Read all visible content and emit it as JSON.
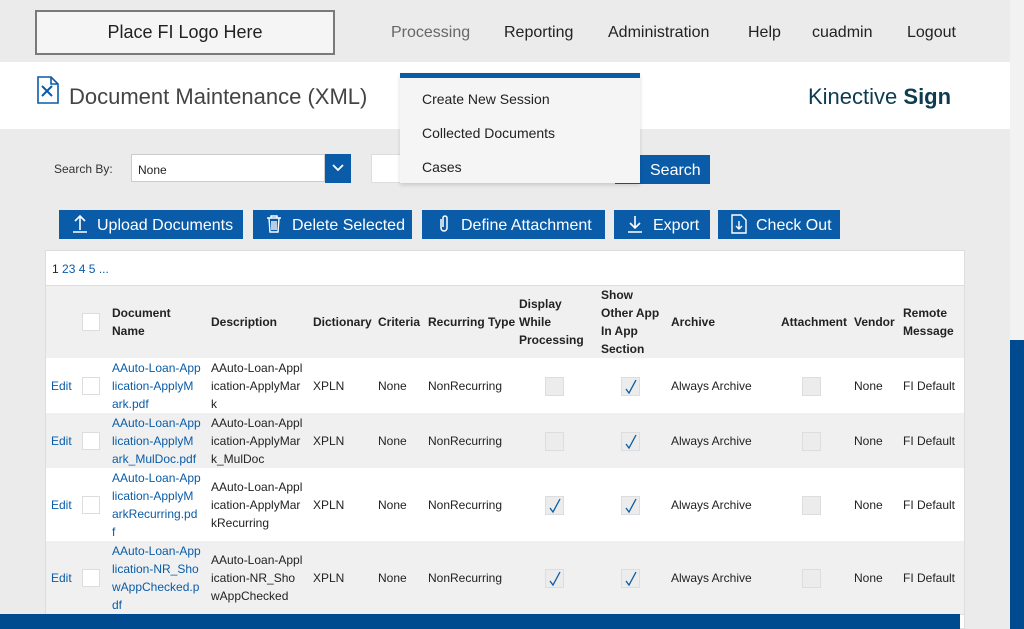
{
  "logo_placeholder": "Place FI Logo Here",
  "nav": {
    "processing": "Processing",
    "reporting": "Reporting",
    "administration": "Administration",
    "help": "Help",
    "user": "cuadmin",
    "logout": "Logout"
  },
  "dropdown": {
    "items": [
      "Create New Session",
      "Collected Documents",
      "Cases"
    ]
  },
  "page_title": "Document Maintenance (XML)",
  "brand": {
    "light": "Kinective ",
    "bold": "Sign"
  },
  "search": {
    "label": "Search By:",
    "selected": "None",
    "button": "Search"
  },
  "actions": {
    "upload": "Upload Documents",
    "delete": "Delete Selected",
    "define": "Define Attachment",
    "export": "Export",
    "checkout": "Check Out"
  },
  "pager": {
    "current": "1",
    "pages": [
      "2",
      "3",
      "4",
      "5"
    ],
    "more": "..."
  },
  "table": {
    "headers": {
      "document_name": [
        "Document",
        "Name"
      ],
      "description": "Description",
      "dictionary": "Dictionary",
      "criteria": "Criteria",
      "recurring_type": "Recurring Type",
      "display_while_processing": [
        "Display",
        "While",
        "Processing"
      ],
      "show_other_app": [
        "Show",
        "Other App",
        "In App",
        "Section"
      ],
      "archive": "Archive",
      "attachment": "Attachment",
      "vendor": "Vendor",
      "remote_message": [
        "Remote",
        "Message"
      ]
    },
    "edit_label": "Edit",
    "rows": [
      {
        "name_lines": [
          "AAuto-Loan-App",
          "lication-ApplyM",
          "ark.pdf"
        ],
        "desc_lines": [
          "AAuto-Loan-Appl",
          "ication-ApplyMar",
          "k"
        ],
        "dictionary": "XPLN",
        "criteria": "None",
        "recurring": "NonRecurring",
        "display_while_processing": false,
        "show_other_app": true,
        "archive": "Always Archive",
        "attachment": false,
        "vendor": "None",
        "remote_message": "FI Default"
      },
      {
        "name_lines": [
          "AAuto-Loan-App",
          "lication-ApplyM",
          "ark_MulDoc.pdf"
        ],
        "desc_lines": [
          "AAuto-Loan-Appl",
          "ication-ApplyMar",
          "k_MulDoc"
        ],
        "dictionary": "XPLN",
        "criteria": "None",
        "recurring": "NonRecurring",
        "display_while_processing": false,
        "show_other_app": true,
        "archive": "Always Archive",
        "attachment": false,
        "vendor": "None",
        "remote_message": "FI Default"
      },
      {
        "name_lines": [
          "AAuto-Loan-App",
          "lication-ApplyM",
          "arkRecurring.pd",
          "f"
        ],
        "desc_lines": [
          "AAuto-Loan-Appl",
          "ication-ApplyMar",
          "kRecurring"
        ],
        "dictionary": "XPLN",
        "criteria": "None",
        "recurring": "NonRecurring",
        "display_while_processing": true,
        "show_other_app": true,
        "archive": "Always Archive",
        "attachment": false,
        "vendor": "None",
        "remote_message": "FI Default"
      },
      {
        "name_lines": [
          "AAuto-Loan-App",
          "lication-NR_Sho",
          "wAppChecked.p",
          "df"
        ],
        "desc_lines": [
          "AAuto-Loan-Appl",
          "ication-NR_Sho",
          "wAppChecked"
        ],
        "dictionary": "XPLN",
        "criteria": "None",
        "recurring": "NonRecurring",
        "display_while_processing": true,
        "show_other_app": true,
        "archive": "Always Archive",
        "attachment": false,
        "vendor": "None",
        "remote_message": "FI Default"
      }
    ]
  },
  "colors": {
    "primary": "#0a5ca8",
    "dark_bar": "#004a8f",
    "brand_text": "#0d3b4f"
  }
}
